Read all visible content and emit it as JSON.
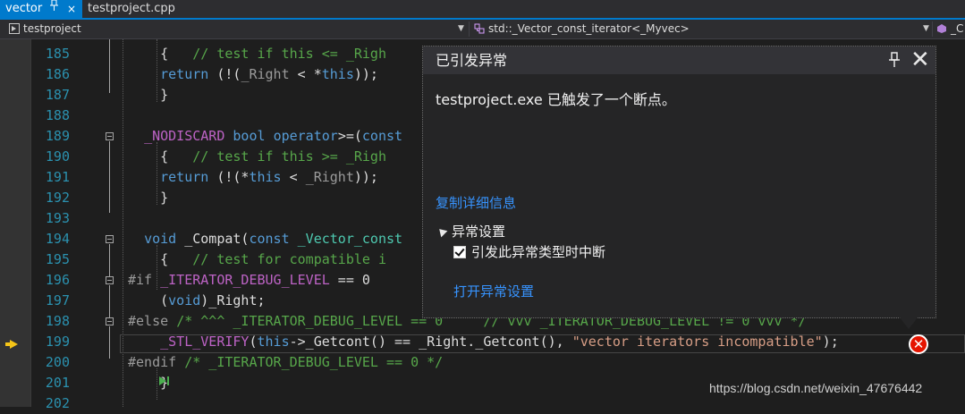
{
  "tabs": [
    {
      "label": "vector",
      "pin": "ᵎ",
      "close": "×"
    },
    {
      "label": "testproject.cpp"
    }
  ],
  "navbar": {
    "project": "testproject",
    "scope": "std::_Vector_const_iterator<_Myvec>",
    "member": "_C"
  },
  "code_lines": [
    {
      "n": "185",
      "html": "    {   <span class='cm'>// test if this &lt;= _Righ</span>"
    },
    {
      "n": "186",
      "html": "    <span class='kw'>return</span> (!(<span class='gr'>_Right</span> &lt; *<span class='kw'>this</span>));"
    },
    {
      "n": "187",
      "html": "    }"
    },
    {
      "n": "188",
      "html": ""
    },
    {
      "n": "189",
      "html": "  <span class='mc'>_NODISCARD</span> <span class='kw'>bool</span> <span class='kw'>operator</span>&gt;=(<span class='kw'>const</span>"
    },
    {
      "n": "190",
      "html": "    {   <span class='cm'>// test if this &gt;= _Righ</span>"
    },
    {
      "n": "191",
      "html": "    <span class='kw'>return</span> (!(*<span class='kw'>this</span> &lt; <span class='gr'>_Right</span>));"
    },
    {
      "n": "192",
      "html": "    }"
    },
    {
      "n": "193",
      "html": ""
    },
    {
      "n": "194",
      "html": "  <span class='kw'>void</span> _Compat(<span class='kw'>const</span> <span class='ty'>_Vector_const</span>"
    },
    {
      "n": "195",
      "html": "    {   <span class='cm'>// test for compatible i</span>"
    },
    {
      "n": "196",
      "html": "<span class='gr'>#if</span> <span class='mc'>_ITERATOR_DEBUG_LEVEL</span> == 0"
    },
    {
      "n": "197",
      "html": "    (<span class='kw'>void</span>)_Right;"
    },
    {
      "n": "198",
      "html": "<span class='gr'>#else</span> <span class='cm'>/* ^^^ _ITERATOR_DEBUG_LEVEL == 0     // vvv _ITERATOR_DEBUG_LEVEL != 0 vvv */</span>"
    },
    {
      "n": "199",
      "html": "    <span class='mc'>_STL_VERIFY</span>(<span class='kw'>this</span>-&gt;_Getcont() == _Right._Getcont(), <span class='st'>\"vector iterators incompatible\"</span>);"
    },
    {
      "n": "200",
      "html": "<span class='gr'>#endif</span> <span class='cm'>/* _ITERATOR_DEBUG_LEVEL == 0 */</span>"
    },
    {
      "n": "201",
      "html": "    }"
    },
    {
      "n": "202",
      "html": ""
    }
  ],
  "popup": {
    "title": "已引发异常",
    "message": "testproject.exe 已触发了一个断点。",
    "copy_details": "复制详细信息",
    "section": "异常设置",
    "checkbox_label": "引发此异常类型时中断",
    "checkbox_checked": true,
    "open_settings": "打开异常设置"
  },
  "watermark": "https://blog.csdn.net/weixin_47676442",
  "colors": {
    "accent": "#007acc",
    "error": "#e51400",
    "link": "#3794ff"
  },
  "icons": {
    "pin": "pin-icon",
    "close": "close-icon",
    "error": "error-icon",
    "current_statement": "arrow-right-icon"
  }
}
